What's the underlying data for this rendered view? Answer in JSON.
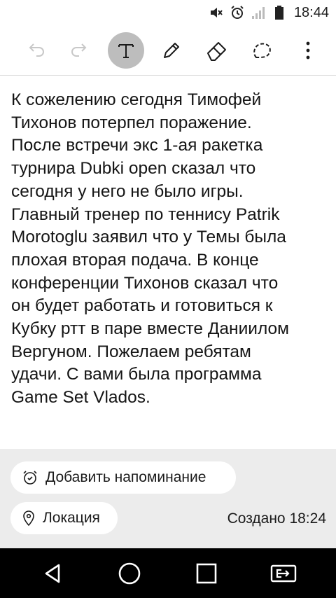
{
  "status_bar": {
    "time": "18:44",
    "icons": [
      "mute-icon",
      "alarm-icon",
      "signal-icon",
      "battery-icon"
    ]
  },
  "toolbar": {
    "tools": [
      "undo-icon",
      "redo-icon",
      "text-tool-icon",
      "pen-icon",
      "eraser-icon",
      "lasso-icon",
      "more-options-icon"
    ],
    "active_tool": "text-tool-icon"
  },
  "note": {
    "body": "К сожелению сегодня Тимофей\nТихонов потерпел поражение.\nПосле встречи экс 1-ая ракетка\nтурнира Dubki open сказал что\nсегодня у него не было игры.\nГлавный тренер по теннису Patrik\nMorotoglu заявил что у Темы была\nплохая вторая подача. В конце\nконференции Тихонов сказал что\nон будет работать и готовиться к\nКубку ртт в паре вместе Даниилом\nВергуном. Пожелаем ребятам\nудачи. С вами была программа\nGame Set Vlados."
  },
  "panel": {
    "reminder_label": "Добавить напоминание",
    "location_label": "Локация",
    "created_text": "Создано 18:24"
  },
  "navbar": {
    "buttons": [
      "back-icon",
      "home-icon",
      "recents-icon",
      "screen-mirror-icon"
    ]
  },
  "colors": {
    "active_tool_bg": "#bdbdbd",
    "panel_bg": "#ececec",
    "navbar_bg": "#000000"
  }
}
